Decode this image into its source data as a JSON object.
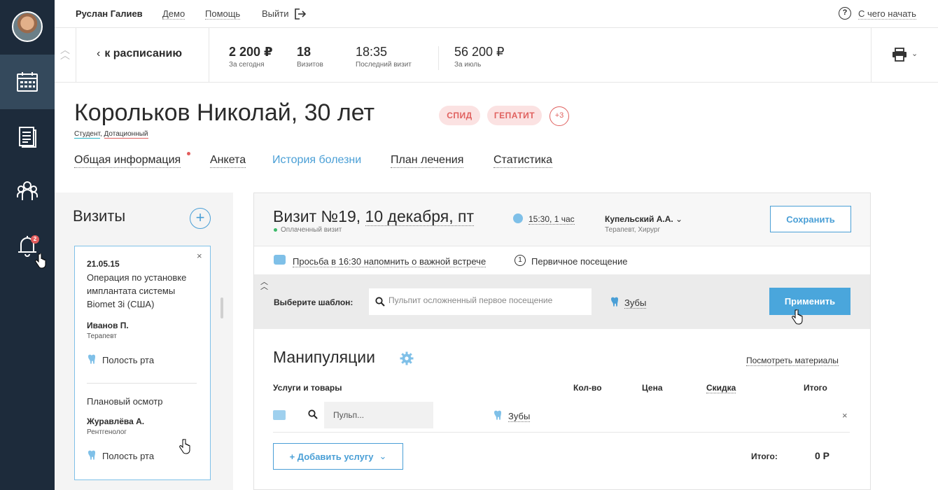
{
  "colors": {
    "sidebar": "#1d2b3b",
    "accent": "#4a9fd6",
    "danger": "#e0615f",
    "paid": "#3cba6a"
  },
  "sidebar": {
    "items": [
      {
        "icon": "calendar-icon",
        "active": true
      },
      {
        "icon": "document-icon",
        "active": false
      },
      {
        "icon": "team-icon",
        "active": false
      },
      {
        "icon": "bell-icon",
        "active": false,
        "badge": "2"
      }
    ]
  },
  "topbar": {
    "user_name": "Руслан Галиев",
    "links": [
      "Демо",
      "Помощь",
      "Выйти"
    ],
    "help_icon": "?",
    "help_label": "С чего начать"
  },
  "stats": {
    "back_label": "к расписанию",
    "items": [
      {
        "value": "2 200 ₽",
        "label": "За сегодня"
      },
      {
        "value": "18",
        "label": "Визитов"
      },
      {
        "value": "18:35",
        "label": "Последний визит"
      },
      {
        "value": "56 200 ₽",
        "label": "За июль"
      }
    ]
  },
  "patient": {
    "name": "Корольков Николай, 30 лет",
    "tags": [
      "СПИД",
      "ГЕПАТИТ"
    ],
    "tags_more": "+3",
    "sub1": "Студент",
    "sub_sep": ", ",
    "sub2": "Дотационный",
    "tabs": [
      "Общая информация",
      "Анкета",
      "История болезни",
      "План лечения",
      "Статистика"
    ]
  },
  "visits": {
    "title": "Визиты",
    "add_label": "+",
    "card": {
      "close": "×",
      "date": "21.05.15",
      "desc_lines": [
        "Операция по установке",
        "имплантата системы",
        "Biomet 3i (США)"
      ],
      "doctor1": "Иванов П.",
      "role1": "Терапевт",
      "area1": "Полость рта",
      "desc2": "Плановый осмотр",
      "doctor2": "Журавлёва А.",
      "role2": "Рентгенолог",
      "area2": "Полость рта"
    }
  },
  "visit": {
    "title_prefix": "Визит №19, ",
    "title_date": "10 декабря, пт",
    "paid": "Оплаченный визит",
    "time": "15:30, 1 час",
    "doctor": "Купельский А.А.",
    "doctor_role": "Терапевт, Хирург",
    "save": "Сохранить",
    "reminder": "Просьба в 16:30 напомнить о важной встрече",
    "first_icon": "1",
    "first_visit": "Первичное посещение",
    "template_label": "Выберите шаблон:",
    "template_placeholder": "Пульпит осложненный первое посещение",
    "template_teeth": "Зубы",
    "apply": "Применить"
  },
  "manipulations": {
    "title": "Манипуляции",
    "materials_link": "Посмотреть материалы",
    "columns": [
      "Услуги и товары",
      "Кол-во",
      "Цена",
      "Скидка",
      "Итого"
    ],
    "row_placeholder": "Пульп...",
    "row_teeth": "Зубы",
    "row_remove": "×",
    "add_service": "+ Добавить услугу",
    "add_chevron": "⌄",
    "total_label": "Итого:",
    "total_value": "0 Р"
  }
}
